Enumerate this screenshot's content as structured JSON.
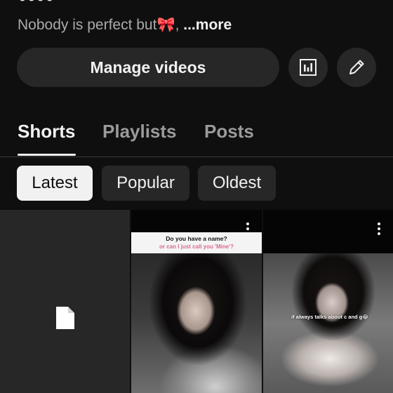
{
  "profile": {
    "bio_text": "Nobody is perfect but🎀, ",
    "bio_more": "...more"
  },
  "actions": {
    "manage_label": "Manage videos",
    "stats_icon": "analytics-icon",
    "edit_icon": "pencil-icon"
  },
  "tabs": [
    {
      "label": "Shorts",
      "active": true
    },
    {
      "label": "Playlists",
      "active": false
    },
    {
      "label": "Posts",
      "active": false
    }
  ],
  "filters": [
    {
      "label": "Latest",
      "selected": true
    },
    {
      "label": "Popular",
      "selected": false
    },
    {
      "label": "Oldest",
      "selected": false
    }
  ],
  "shorts": [
    {
      "type": "placeholder",
      "icon": "document-icon"
    },
    {
      "type": "video",
      "caption_line1": "Do you have a name?",
      "caption_line2": "or can I just call you 'Mine'?"
    },
    {
      "type": "video",
      "overlay_text": "if always talks about c and g😂"
    }
  ],
  "colors": {
    "background": "#0f0f0f",
    "button_bg": "#272727",
    "text_primary": "#f1f1f1",
    "text_secondary": "#aaaaaa",
    "chip_selected_bg": "#f1f1f1",
    "caption_pink": "#d86a93"
  }
}
